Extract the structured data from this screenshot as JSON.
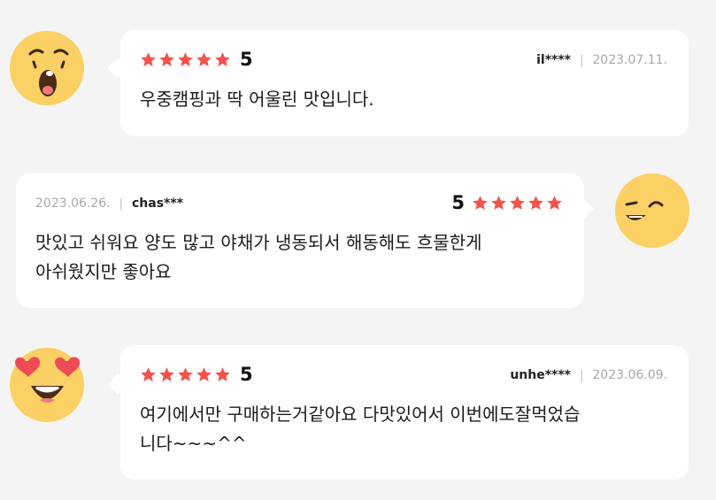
{
  "reviews": [
    {
      "rating": 5,
      "rating_label": "5",
      "user": "il****",
      "date": "2023.07.11.",
      "text": "우중캠핑과 딱 어울린 맛입니다.",
      "avatar_icon": "surprised-face-icon"
    },
    {
      "rating": 5,
      "rating_label": "5",
      "user": "chas***",
      "date": "2023.06.26.",
      "text_lines": [
        "맛있고 쉬워요 양도 많고 야채가 냉동되서 해동해도 흐물한게",
        "아쉬웠지만 좋아요"
      ],
      "avatar_icon": "winking-face-icon"
    },
    {
      "rating": 5,
      "rating_label": "5",
      "user": "unhe****",
      "date": "2023.06.09.",
      "text_lines": [
        "여기에서만 구매하는거같아요 다맛있어서 이번에도잘먹었습",
        "니다~~~^^"
      ],
      "avatar_icon": "heart-eyes-face-icon"
    }
  ],
  "colors": {
    "star": "#f4524d",
    "avatar_fill": "#fbd064",
    "heart": "#ef4b57",
    "bubble": "#ffffff",
    "background": "#f4f4f4"
  }
}
